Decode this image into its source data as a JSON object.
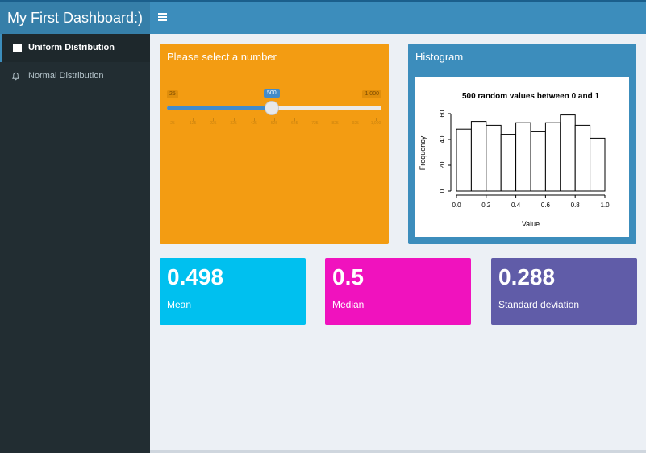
{
  "header": {
    "title": "My First Dashboard:)"
  },
  "sidebar": {
    "items": [
      {
        "label": "Uniform Distribution",
        "icon": "square-icon",
        "active": true
      },
      {
        "label": "Normal Distribution",
        "icon": "bell-icon",
        "active": false
      }
    ]
  },
  "slider_box": {
    "title": "Please select a number",
    "min_label": "25",
    "max_label": "1,000",
    "current_label": "500",
    "current_value": 500,
    "min": 25,
    "max": 1000,
    "tick_labels": [
      "25",
      "125",
      "225",
      "325",
      "425",
      "525",
      "625",
      "725",
      "825",
      "925",
      "1,000"
    ]
  },
  "hist_box": {
    "title": "Histogram"
  },
  "chart_data": {
    "type": "bar",
    "title": "500 random values between 0 and 1",
    "xlabel": "Value",
    "ylabel": "Frequency",
    "bin_edges": [
      0.0,
      0.1,
      0.2,
      0.3,
      0.4,
      0.5,
      0.6,
      0.7,
      0.8,
      0.9,
      1.0
    ],
    "values": [
      48,
      54,
      51,
      44,
      53,
      46,
      53,
      59,
      51,
      41
    ],
    "xticks": [
      "0.0",
      "0.2",
      "0.4",
      "0.6",
      "0.8",
      "1.0"
    ],
    "yticks": [
      "0",
      "20",
      "40",
      "60"
    ],
    "xlim": [
      0,
      1
    ],
    "ylim": [
      0,
      60
    ]
  },
  "value_boxes": [
    {
      "value": "0.498",
      "label": "Mean",
      "color": "#00c0ef"
    },
    {
      "value": "0.5",
      "label": "Median",
      "color": "#f012be"
    },
    {
      "value": "0.288",
      "label": "Standard deviation",
      "color": "#605ca8"
    }
  ],
  "colors": {
    "accent": "#3c8dbc",
    "slider_box": "#f39c12",
    "sidebar": "#222d32"
  }
}
